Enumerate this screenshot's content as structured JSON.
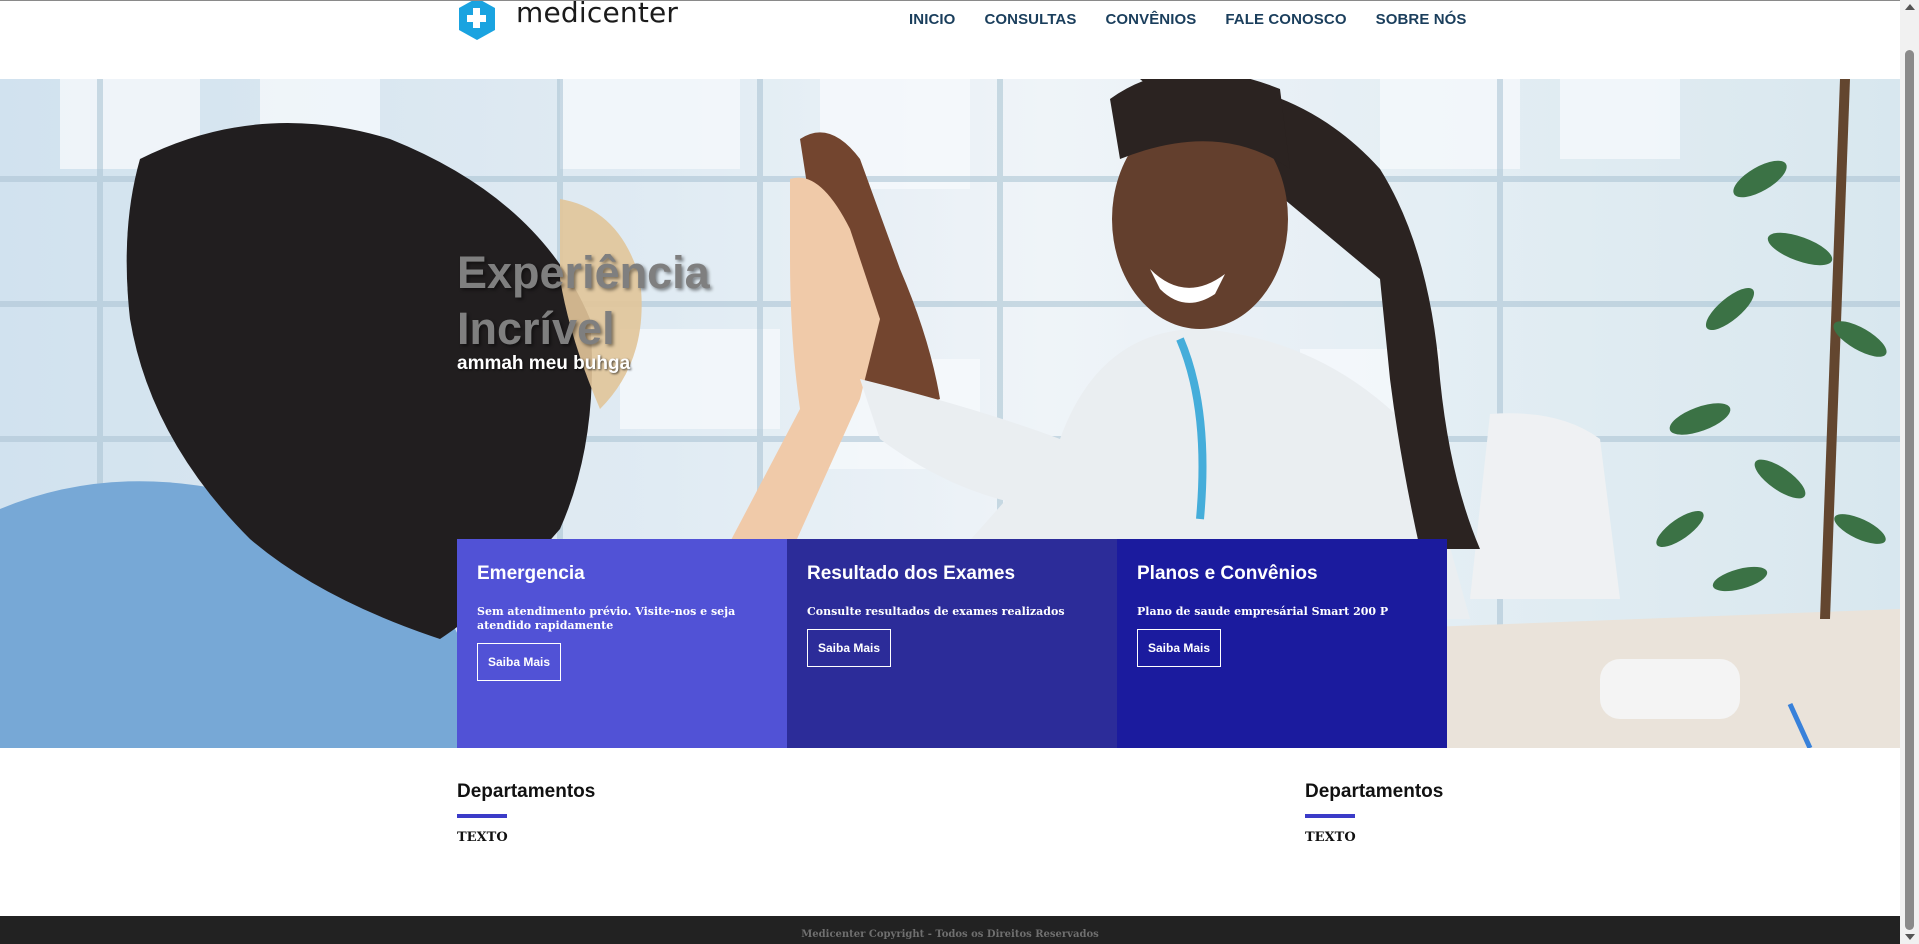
{
  "brand": {
    "name": "medicenter"
  },
  "nav": {
    "items": [
      "INICIO",
      "CONSULTAS",
      "CONVÊNIOS",
      "FALE CONOSCO",
      "SOBRE NÓS"
    ]
  },
  "hero": {
    "title": "Experiência Incrível",
    "subtitle": "ammah meu buhga"
  },
  "cards": [
    {
      "title": "Emergencia",
      "text": "Sem atendimento prévio. Visite-nos e seja atendido rapidamente",
      "button": "Saiba Mais",
      "color": "#5152d6"
    },
    {
      "title": "Resultado dos Exames",
      "text": "Consulte resultados de exames realizados",
      "button": "Saiba Mais",
      "color": "#2c2c99"
    },
    {
      "title": "Planos e Convênios",
      "text": "Plano de saude empresárial Smart 200 P",
      "button": "Saiba Mais",
      "color": "#1b1b9e"
    }
  ],
  "departments": [
    {
      "title": "Departamentos",
      "text": "TEXTO"
    },
    {
      "title": "Departamentos",
      "text": "TEXTO"
    }
  ],
  "footer": {
    "text": "Medicenter Copyright - Todos os Direitos Reservados"
  },
  "colors": {
    "accent": "#3b3bc8",
    "logo": "#1aa3e0",
    "nav": "#1a3e5c",
    "footer_bg": "#222222"
  }
}
